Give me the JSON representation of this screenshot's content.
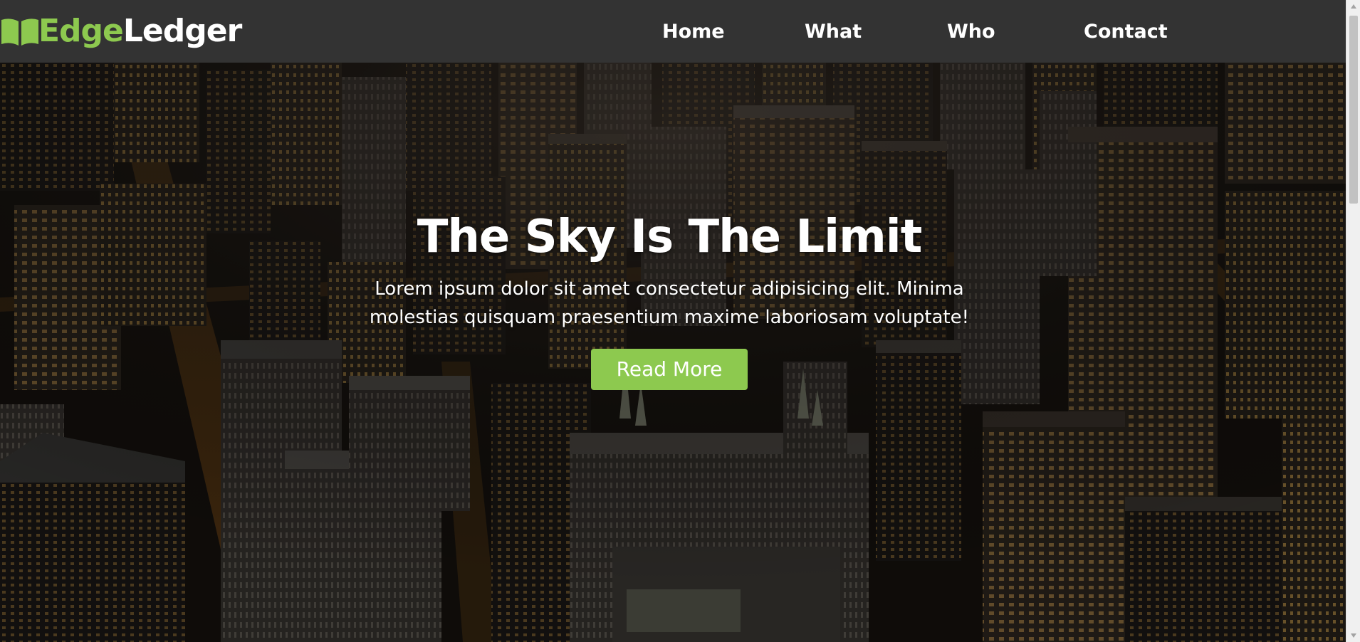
{
  "header": {
    "brand": {
      "icon": "open-book-icon",
      "part1": "Edge",
      "part2": "Ledger"
    },
    "nav": [
      {
        "label": "Home"
      },
      {
        "label": "What"
      },
      {
        "label": "Who"
      },
      {
        "label": "Contact"
      }
    ]
  },
  "hero": {
    "title": "The Sky Is The Limit",
    "text_line1": "Lorem ipsum dolor sit amet consectetur adipisicing elit. Minima",
    "text_line2": "molestias quisquam praesentium maxime laboriosam voluptate!",
    "button_label": "Read More",
    "background": "night-city-aerial-image"
  },
  "colors": {
    "accent": "#8dc94f",
    "navbar": "#333333",
    "text": "#ffffff"
  }
}
